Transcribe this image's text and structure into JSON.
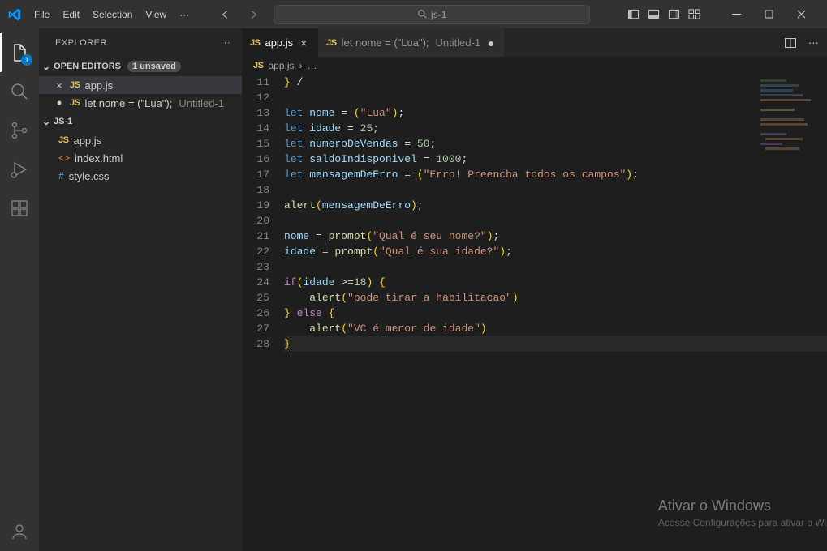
{
  "titlebar": {
    "menu": [
      "File",
      "Edit",
      "Selection",
      "View"
    ],
    "search_text": "js-1"
  },
  "activity": {
    "explorer_badge": "1"
  },
  "sidebar": {
    "title": "EXPLORER",
    "sections": {
      "open_editors": {
        "label": "OPEN EDITORS",
        "unsaved_badge": "1 unsaved",
        "items": [
          {
            "icon": "close",
            "lang": "JS",
            "name": "app.js",
            "subtitle": "",
            "active": true
          },
          {
            "icon": "dot",
            "lang": "JS",
            "name": "let nome = (\"Lua\");",
            "subtitle": "Untitled-1",
            "active": false
          }
        ]
      },
      "workspace": {
        "label": "JS-1",
        "items": [
          {
            "lang": "JS",
            "name": "app.js"
          },
          {
            "lang": "HTML",
            "name": "index.html"
          },
          {
            "lang": "CSS",
            "name": "style.css"
          }
        ]
      }
    }
  },
  "tabs": [
    {
      "lang": "JS",
      "name": "app.js",
      "modified": false,
      "close": true,
      "active": true
    },
    {
      "lang": "JS",
      "name": "let nome = (\"Lua\");",
      "subtitle": "Untitled-1",
      "modified": true,
      "close": false,
      "active": false
    }
  ],
  "breadcrumb": {
    "icon": "JS",
    "file": "app.js",
    "suffix": "…"
  },
  "code": {
    "first_line_no": 11,
    "last_line_no": 28,
    "cursor_line_no": 28,
    "lines": [
      [
        {
          "c": "paren",
          "t": "}"
        },
        {
          "c": "op",
          "t": " /"
        }
      ],
      [],
      [
        {
          "c": "keyword",
          "t": "let"
        },
        {
          "c": "op",
          "t": " "
        },
        {
          "c": "var",
          "t": "nome"
        },
        {
          "c": "op",
          "t": " = "
        },
        {
          "c": "paren",
          "t": "("
        },
        {
          "c": "string",
          "t": "\"Lua\""
        },
        {
          "c": "paren",
          "t": ")"
        },
        {
          "c": "op",
          "t": ";"
        }
      ],
      [
        {
          "c": "keyword",
          "t": "let"
        },
        {
          "c": "op",
          "t": " "
        },
        {
          "c": "var",
          "t": "idade"
        },
        {
          "c": "op",
          "t": " = "
        },
        {
          "c": "num",
          "t": "25"
        },
        {
          "c": "op",
          "t": ";"
        }
      ],
      [
        {
          "c": "keyword",
          "t": "let"
        },
        {
          "c": "op",
          "t": " "
        },
        {
          "c": "var",
          "t": "numeroDeVendas"
        },
        {
          "c": "op",
          "t": " = "
        },
        {
          "c": "num",
          "t": "50"
        },
        {
          "c": "op",
          "t": ";"
        }
      ],
      [
        {
          "c": "keyword",
          "t": "let"
        },
        {
          "c": "op",
          "t": " "
        },
        {
          "c": "var",
          "t": "saldoIndisponivel"
        },
        {
          "c": "op",
          "t": " = "
        },
        {
          "c": "num",
          "t": "1000"
        },
        {
          "c": "op",
          "t": ";"
        }
      ],
      [
        {
          "c": "keyword",
          "t": "let"
        },
        {
          "c": "op",
          "t": " "
        },
        {
          "c": "var",
          "t": "mensagemDeErro"
        },
        {
          "c": "op",
          "t": " = "
        },
        {
          "c": "paren",
          "t": "("
        },
        {
          "c": "string",
          "t": "\"Erro! Preencha todos os campos\""
        },
        {
          "c": "paren",
          "t": ")"
        },
        {
          "c": "op",
          "t": ";"
        }
      ],
      [],
      [
        {
          "c": "func",
          "t": "alert"
        },
        {
          "c": "paren",
          "t": "("
        },
        {
          "c": "var",
          "t": "mensagemDeErro"
        },
        {
          "c": "paren",
          "t": ")"
        },
        {
          "c": "op",
          "t": ";"
        }
      ],
      [],
      [
        {
          "c": "var",
          "t": "nome"
        },
        {
          "c": "op",
          "t": " = "
        },
        {
          "c": "func",
          "t": "prompt"
        },
        {
          "c": "paren",
          "t": "("
        },
        {
          "c": "string",
          "t": "\"Qual é seu nome?\""
        },
        {
          "c": "paren",
          "t": ")"
        },
        {
          "c": "op",
          "t": ";"
        }
      ],
      [
        {
          "c": "var",
          "t": "idade"
        },
        {
          "c": "op",
          "t": " = "
        },
        {
          "c": "func",
          "t": "prompt"
        },
        {
          "c": "paren",
          "t": "("
        },
        {
          "c": "string",
          "t": "\"Qual é sua idade?\""
        },
        {
          "c": "paren",
          "t": ")"
        },
        {
          "c": "op",
          "t": ";"
        }
      ],
      [],
      [
        {
          "c": "control",
          "t": "if"
        },
        {
          "c": "paren",
          "t": "("
        },
        {
          "c": "var",
          "t": "idade"
        },
        {
          "c": "op",
          "t": " >="
        },
        {
          "c": "num",
          "t": "18"
        },
        {
          "c": "paren",
          "t": ")"
        },
        {
          "c": "op",
          "t": " "
        },
        {
          "c": "paren",
          "t": "{"
        }
      ],
      [
        {
          "c": "op",
          "t": "    "
        },
        {
          "c": "func",
          "t": "alert"
        },
        {
          "c": "paren",
          "t": "("
        },
        {
          "c": "string",
          "t": "\"pode tirar a habilitacao\""
        },
        {
          "c": "paren",
          "t": ")"
        }
      ],
      [
        {
          "c": "paren",
          "t": "}"
        },
        {
          "c": "op",
          "t": " "
        },
        {
          "c": "control",
          "t": "else"
        },
        {
          "c": "op",
          "t": " "
        },
        {
          "c": "paren",
          "t": "{"
        }
      ],
      [
        {
          "c": "op",
          "t": "    "
        },
        {
          "c": "func",
          "t": "alert"
        },
        {
          "c": "paren",
          "t": "("
        },
        {
          "c": "string",
          "t": "\"VC é menor de idade\""
        },
        {
          "c": "paren",
          "t": ")"
        }
      ],
      [
        {
          "c": "paren",
          "t": "}"
        }
      ]
    ]
  },
  "watermark": {
    "title": "Ativar o Windows",
    "subtitle": "Acesse Configurações para ativar o Win"
  }
}
